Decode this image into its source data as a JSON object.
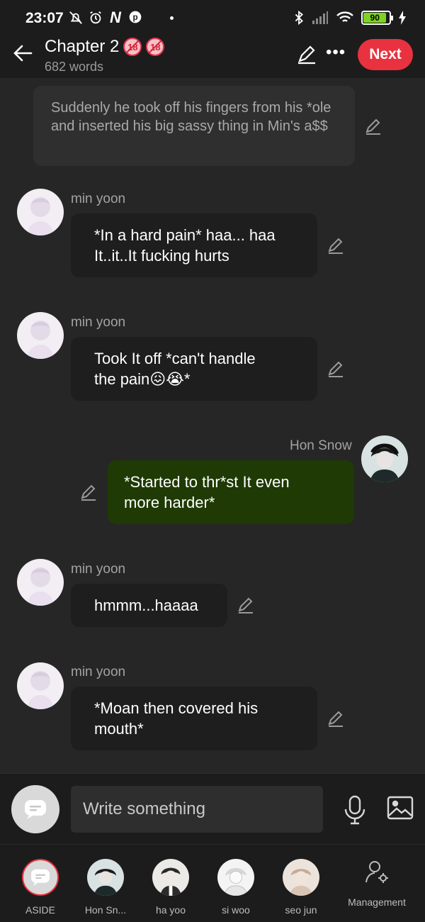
{
  "status_bar": {
    "time": "23:07",
    "battery": "90"
  },
  "header": {
    "title": "Chapter 2",
    "badges": [
      "18-restricted-icon",
      "18-restricted-icon"
    ],
    "words": "682 words",
    "next_label": "Next"
  },
  "chat": {
    "narration": "Suddenly he took off his fingers from his *ole and inserted his big sassy thing in Min's a$$",
    "messages": [
      {
        "sender": "min yoon",
        "text_lines": [
          "*In a hard pain* haa... haa",
          "It..it..It fucking hurts"
        ]
      },
      {
        "sender": "min yoon",
        "text_lines": [
          "Took It off *can't handle",
          "the pain😖😭*"
        ]
      },
      {
        "sender": "Hon Snow",
        "text_lines": [
          "*Started to thr*st It even",
          "more harder*"
        ]
      },
      {
        "sender": "min yoon",
        "text_lines": [
          "hmmm...haaaa"
        ]
      },
      {
        "sender": "min yoon",
        "text_lines": [
          "*Moan then covered his",
          "mouth*"
        ]
      }
    ]
  },
  "input": {
    "placeholder": "Write something"
  },
  "bottom_tabs": [
    {
      "label": "ASIDE"
    },
    {
      "label": "Hon Sn..."
    },
    {
      "label": "ha yoo"
    },
    {
      "label": "si woo"
    },
    {
      "label": "seo jun"
    },
    {
      "label": "Management"
    }
  ],
  "colors": {
    "accent_red": "#e8323f",
    "my_bubble": "#1f3a04",
    "other_bubble": "#1e1e1e",
    "background": "#262626"
  }
}
